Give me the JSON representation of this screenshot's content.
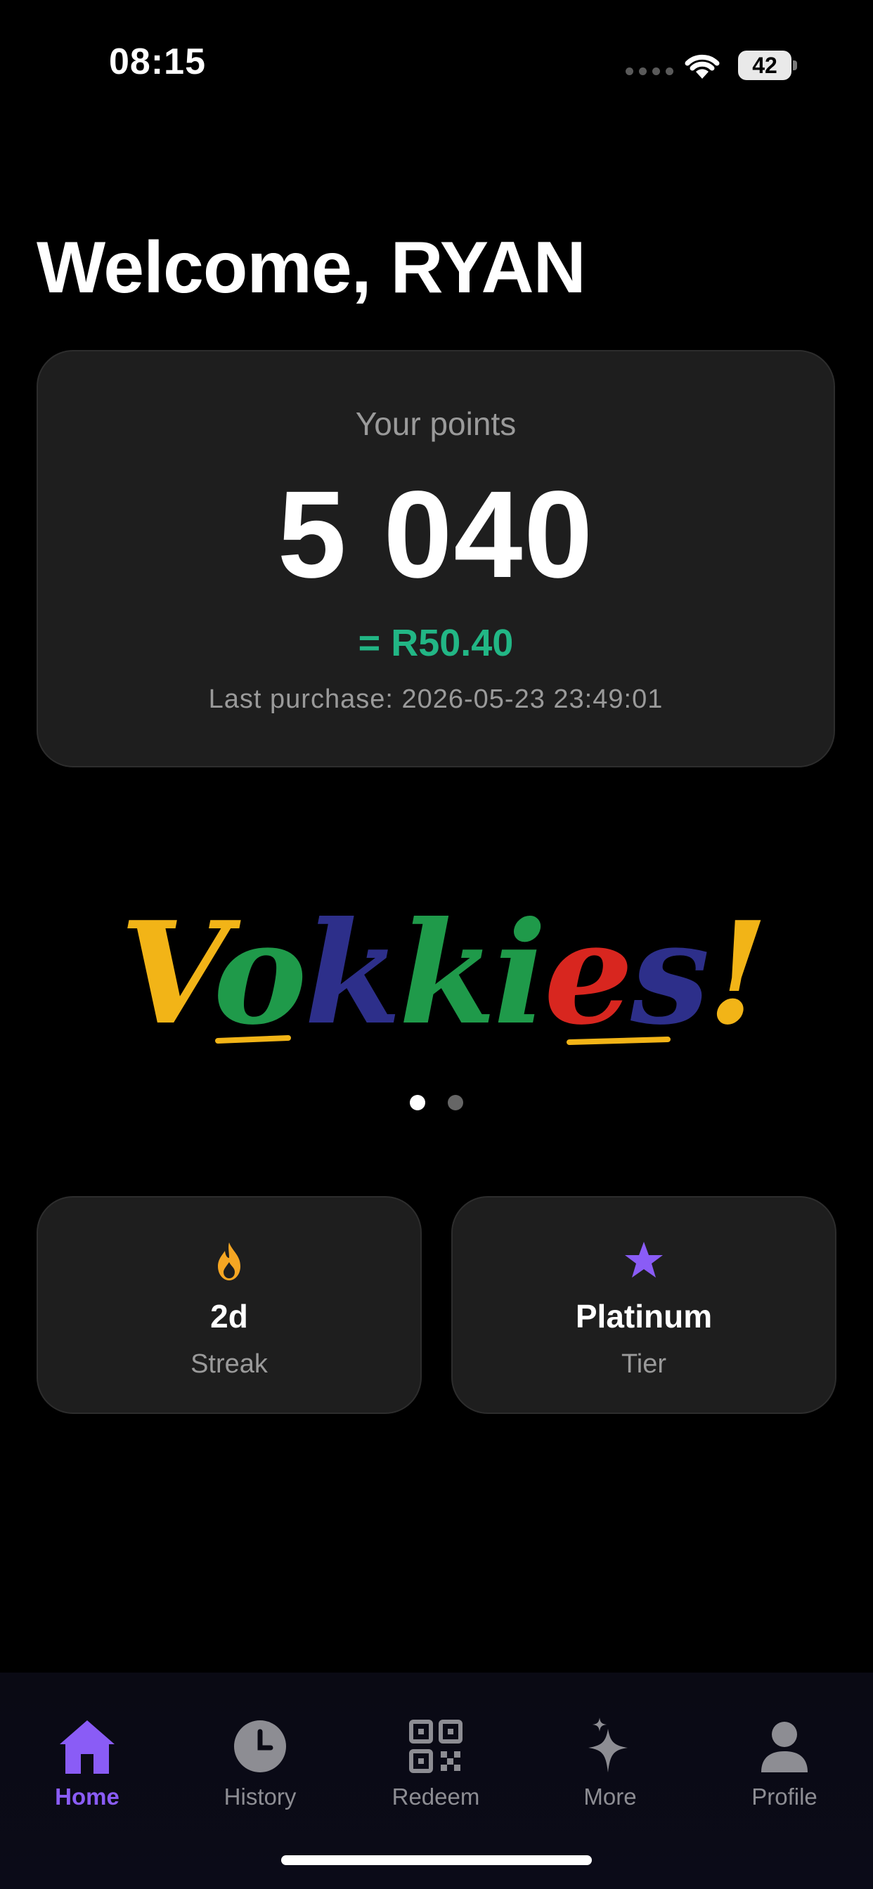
{
  "status_bar": {
    "time": "08:15",
    "battery": "42"
  },
  "welcome": "Welcome, RYAN",
  "points_card": {
    "label": "Your points",
    "value": "5 040",
    "money": "= R50.40",
    "last_purchase": "Last purchase: 2026-05-23 23:49:01"
  },
  "banner": {
    "brand": "Vokkies!",
    "letter_colors": [
      "#f2b417",
      "#1f9a4a",
      "#2d2f8a",
      "#1f9a4a",
      "#1f9a4a",
      "#d8261f",
      "#2d2f8a",
      "#f2b417",
      "#d8261f"
    ],
    "page_count": 2,
    "active_page": 1
  },
  "stats": [
    {
      "icon": "fire-icon",
      "value": "2d",
      "label": "Streak",
      "color": "#f5a623"
    },
    {
      "icon": "star-icon",
      "value": "Platinum",
      "label": "Tier",
      "color": "#8a5cf6"
    }
  ],
  "tabs": [
    {
      "label": "Home",
      "icon": "home-icon",
      "active": true
    },
    {
      "label": "History",
      "icon": "clock-icon",
      "active": false
    },
    {
      "label": "Redeem",
      "icon": "qr-code-icon",
      "active": false
    },
    {
      "label": "More",
      "icon": "sparkles-icon",
      "active": false
    },
    {
      "label": "Profile",
      "icon": "person-icon",
      "active": false
    }
  ],
  "colors": {
    "accent": "#8a5cf6",
    "money": "#22b685",
    "card": "#1e1e1e"
  }
}
